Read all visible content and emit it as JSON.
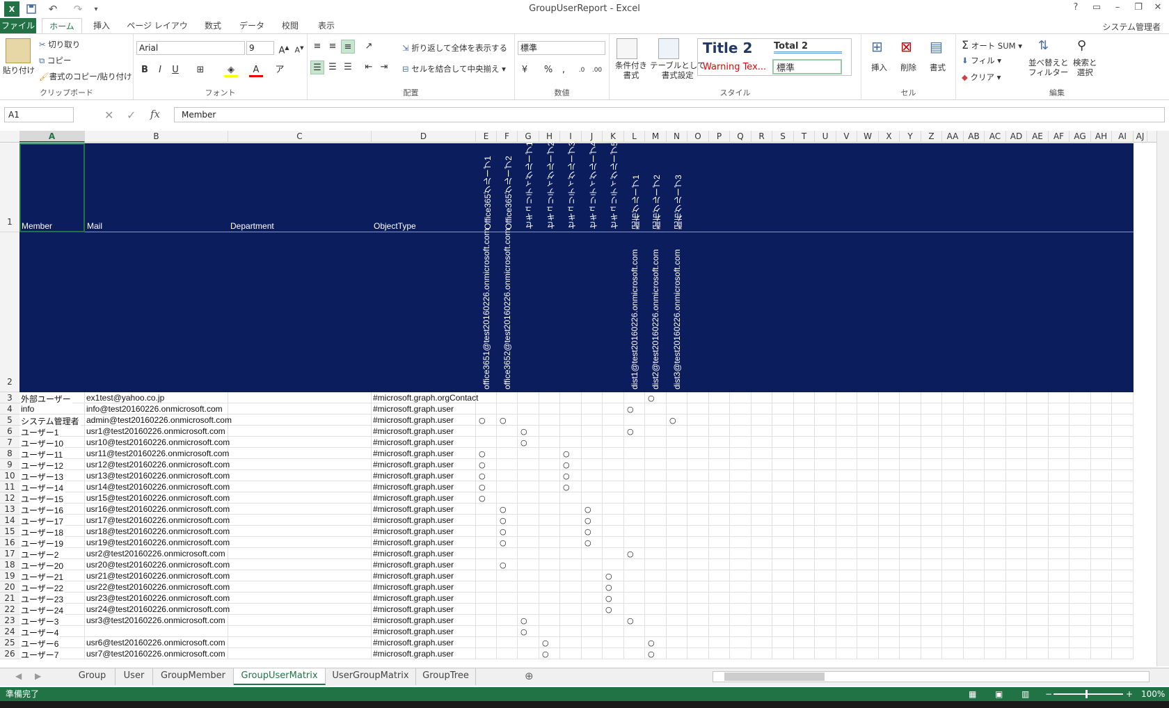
{
  "window": {
    "title": "GroupUserReport - Excel",
    "user": "システム管理者"
  },
  "ribbon_tabs": [
    "ファイル",
    "ホーム",
    "挿入",
    "ページ レイアウト",
    "数式",
    "データ",
    "校閲",
    "表示"
  ],
  "clipboard": {
    "paste": "貼り付け",
    "cut": "切り取り",
    "copy": "コピー",
    "painter": "書式のコピー/貼り付け",
    "label": "クリップボード"
  },
  "font": {
    "name": "Arial",
    "size": "9",
    "bold": "B",
    "italic": "I",
    "underline": "U",
    "label": "フォント"
  },
  "alignment": {
    "wrap": "折り返して全体を表示する",
    "merge": "セルを結合して中央揃え",
    "label": "配置"
  },
  "number": {
    "format": "標準",
    "percent": "%",
    "comma": ",",
    "label": "数値"
  },
  "styles": {
    "cond": "条件付き\n書式",
    "table": "テーブルとして\n書式設定",
    "title2": "Title 2",
    "total2": "Total 2",
    "warning": "Warning Tex...",
    "normal": "標準",
    "label": "スタイル"
  },
  "cells": {
    "insert": "挿入",
    "delete": "削除",
    "format": "書式",
    "label": "セル"
  },
  "editing": {
    "autosum": "オート SUM",
    "fill": "フィル",
    "clear": "クリア",
    "sort": "並べ替えと\nフィルター",
    "find": "検索と\n選択",
    "label": "編集"
  },
  "formula_bar": {
    "name_box": "A1",
    "value": "Member",
    "fx": "fx"
  },
  "columns": [
    "A",
    "B",
    "C",
    "D",
    "E",
    "F",
    "G",
    "H",
    "I",
    "J",
    "K",
    "L",
    "M",
    "N",
    "O",
    "P",
    "Q",
    "R",
    "S",
    "T",
    "U",
    "V",
    "W",
    "X",
    "Y",
    "Z",
    "AA",
    "AB",
    "AC",
    "AD",
    "AE",
    "AF",
    "AG",
    "AH",
    "AI",
    "AJ"
  ],
  "header_row1": [
    "Member",
    "Mail",
    "Department",
    "ObjectType"
  ],
  "group_names": [
    "Office365グループ1",
    "Office365グループ2",
    "セキュリティグループ1",
    "セキュリティグループ2",
    "セキュリティグループ3",
    "セキュリティグループ4",
    "セキュリティグループ5",
    "配布グループ1",
    "配布グループ2",
    "配布グループ3"
  ],
  "group_mails": [
    "office3651@test20160226.onmicrosoft.com",
    "office3652@test20160226.onmicrosoft.com",
    "",
    "",
    "",
    "",
    "",
    "dist1@test20160226.onmicrosoft.com",
    "dist2@test20160226.onmicrosoft.com",
    "dist3@test20160226.onmicrosoft.com"
  ],
  "rows": [
    {
      "n": "3",
      "member": "外部ユーザー",
      "mail": "ex1test@yahoo.co.jp",
      "type": "#microsoft.graph.orgContact",
      "marks": [
        8
      ]
    },
    {
      "n": "4",
      "member": "info",
      "mail": "info@test20160226.onmicrosoft.com",
      "type": "#microsoft.graph.user",
      "marks": [
        7
      ]
    },
    {
      "n": "5",
      "member": "システム管理者",
      "mail": "admin@test20160226.onmicrosoft.com",
      "type": "#microsoft.graph.user",
      "marks": [
        0,
        1,
        9
      ]
    },
    {
      "n": "6",
      "member": "ユーザー1",
      "mail": "usr1@test20160226.onmicrosoft.com",
      "type": "#microsoft.graph.user",
      "marks": [
        2,
        7
      ]
    },
    {
      "n": "7",
      "member": "ユーザー10",
      "mail": "usr10@test20160226.onmicrosoft.com",
      "type": "#microsoft.graph.user",
      "marks": [
        2
      ]
    },
    {
      "n": "8",
      "member": "ユーザー11",
      "mail": "usr11@test20160226.onmicrosoft.com",
      "type": "#microsoft.graph.user",
      "marks": [
        0,
        4
      ]
    },
    {
      "n": "9",
      "member": "ユーザー12",
      "mail": "usr12@test20160226.onmicrosoft.com",
      "type": "#microsoft.graph.user",
      "marks": [
        0,
        4
      ]
    },
    {
      "n": "10",
      "member": "ユーザー13",
      "mail": "usr13@test20160226.onmicrosoft.com",
      "type": "#microsoft.graph.user",
      "marks": [
        0,
        4
      ]
    },
    {
      "n": "11",
      "member": "ユーザー14",
      "mail": "usr14@test20160226.onmicrosoft.com",
      "type": "#microsoft.graph.user",
      "marks": [
        0,
        4
      ]
    },
    {
      "n": "12",
      "member": "ユーザー15",
      "mail": "usr15@test20160226.onmicrosoft.com",
      "type": "#microsoft.graph.user",
      "marks": [
        0
      ]
    },
    {
      "n": "13",
      "member": "ユーザー16",
      "mail": "usr16@test20160226.onmicrosoft.com",
      "type": "#microsoft.graph.user",
      "marks": [
        1,
        5
      ]
    },
    {
      "n": "14",
      "member": "ユーザー17",
      "mail": "usr17@test20160226.onmicrosoft.com",
      "type": "#microsoft.graph.user",
      "marks": [
        1,
        5
      ]
    },
    {
      "n": "15",
      "member": "ユーザー18",
      "mail": "usr18@test20160226.onmicrosoft.com",
      "type": "#microsoft.graph.user",
      "marks": [
        1,
        5
      ]
    },
    {
      "n": "16",
      "member": "ユーザー19",
      "mail": "usr19@test20160226.onmicrosoft.com",
      "type": "#microsoft.graph.user",
      "marks": [
        1,
        5
      ]
    },
    {
      "n": "17",
      "member": "ユーザー2",
      "mail": "usr2@test20160226.onmicrosoft.com",
      "type": "#microsoft.graph.user",
      "marks": [
        7
      ]
    },
    {
      "n": "18",
      "member": "ユーザー20",
      "mail": "usr20@test20160226.onmicrosoft.com",
      "type": "#microsoft.graph.user",
      "marks": [
        1
      ]
    },
    {
      "n": "19",
      "member": "ユーザー21",
      "mail": "usr21@test20160226.onmicrosoft.com",
      "type": "#microsoft.graph.user",
      "marks": [
        6
      ]
    },
    {
      "n": "20",
      "member": "ユーザー22",
      "mail": "usr22@test20160226.onmicrosoft.com",
      "type": "#microsoft.graph.user",
      "marks": [
        6
      ]
    },
    {
      "n": "21",
      "member": "ユーザー23",
      "mail": "usr23@test20160226.onmicrosoft.com",
      "type": "#microsoft.graph.user",
      "marks": [
        6
      ]
    },
    {
      "n": "22",
      "member": "ユーザー24",
      "mail": "usr24@test20160226.onmicrosoft.com",
      "type": "#microsoft.graph.user",
      "marks": [
        6
      ]
    },
    {
      "n": "23",
      "member": "ユーザー3",
      "mail": "usr3@test20160226.onmicrosoft.com",
      "type": "#microsoft.graph.user",
      "marks": [
        2,
        7
      ]
    },
    {
      "n": "24",
      "member": "ユーザー4",
      "mail": "",
      "type": "#microsoft.graph.user",
      "marks": [
        2
      ]
    },
    {
      "n": "25",
      "member": "ユーザー6",
      "mail": "usr6@test20160226.onmicrosoft.com",
      "type": "#microsoft.graph.user",
      "marks": [
        3,
        8
      ]
    },
    {
      "n": "26",
      "member": "ユーザー7",
      "mail": "usr7@test20160226.onmicrosoft.com",
      "type": "#microsoft.graph.user",
      "marks": [
        3,
        8
      ]
    }
  ],
  "mark_symbol": "○",
  "sheet_tabs": [
    "Group",
    "User",
    "GroupMember",
    "GroupUserMatrix",
    "UserGroupMatrix",
    "GroupTree"
  ],
  "active_sheet": "GroupUserMatrix",
  "status": {
    "text": "準備完了",
    "zoom": "100%"
  },
  "colors": {
    "excel_green": "#217346",
    "header_band": "#0c1d5e"
  }
}
